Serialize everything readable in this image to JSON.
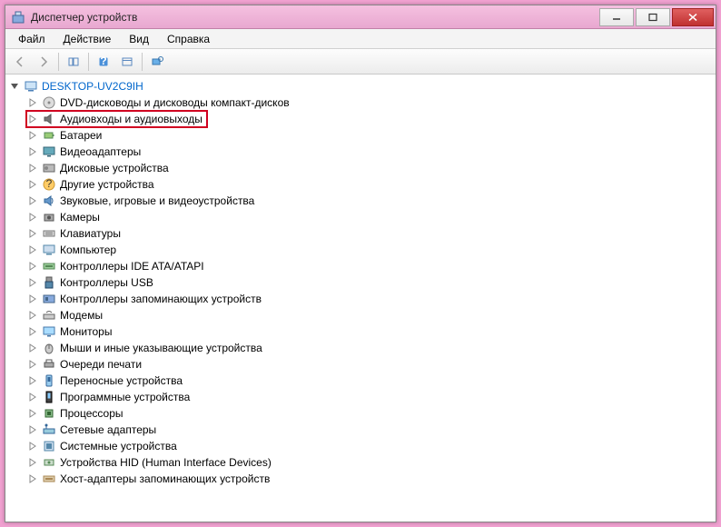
{
  "window": {
    "title": "Диспетчер устройств"
  },
  "menu": {
    "file": "Файл",
    "action": "Действие",
    "view": "Вид",
    "help": "Справка"
  },
  "tree": {
    "root": "DESKTOP-UV2C9IH",
    "items": [
      {
        "label": "DVD-дисководы и дисководы компакт-дисков",
        "icon": "disc"
      },
      {
        "label": "Аудиовходы и аудиовыходы",
        "icon": "audio",
        "highlight": true
      },
      {
        "label": "Батареи",
        "icon": "battery"
      },
      {
        "label": "Видеоадаптеры",
        "icon": "display"
      },
      {
        "label": "Дисковые устройства",
        "icon": "disk"
      },
      {
        "label": "Другие устройства",
        "icon": "unknown"
      },
      {
        "label": "Звуковые, игровые и видеоустройства",
        "icon": "sound"
      },
      {
        "label": "Камеры",
        "icon": "camera"
      },
      {
        "label": "Клавиатуры",
        "icon": "keyboard"
      },
      {
        "label": "Компьютер",
        "icon": "computer"
      },
      {
        "label": "Контроллеры IDE ATA/ATAPI",
        "icon": "ide"
      },
      {
        "label": "Контроллеры USB",
        "icon": "usb"
      },
      {
        "label": "Контроллеры запоминающих устройств",
        "icon": "storage"
      },
      {
        "label": "Модемы",
        "icon": "modem"
      },
      {
        "label": "Мониторы",
        "icon": "monitor"
      },
      {
        "label": "Мыши и иные указывающие устройства",
        "icon": "mouse"
      },
      {
        "label": "Очереди печати",
        "icon": "printer"
      },
      {
        "label": "Переносные устройства",
        "icon": "portable"
      },
      {
        "label": "Программные устройства",
        "icon": "software"
      },
      {
        "label": "Процессоры",
        "icon": "cpu"
      },
      {
        "label": "Сетевые адаптеры",
        "icon": "network"
      },
      {
        "label": "Системные устройства",
        "icon": "system"
      },
      {
        "label": "Устройства HID (Human Interface Devices)",
        "icon": "hid"
      },
      {
        "label": "Хост-адаптеры запоминающих устройств",
        "icon": "hostadapter"
      }
    ]
  }
}
